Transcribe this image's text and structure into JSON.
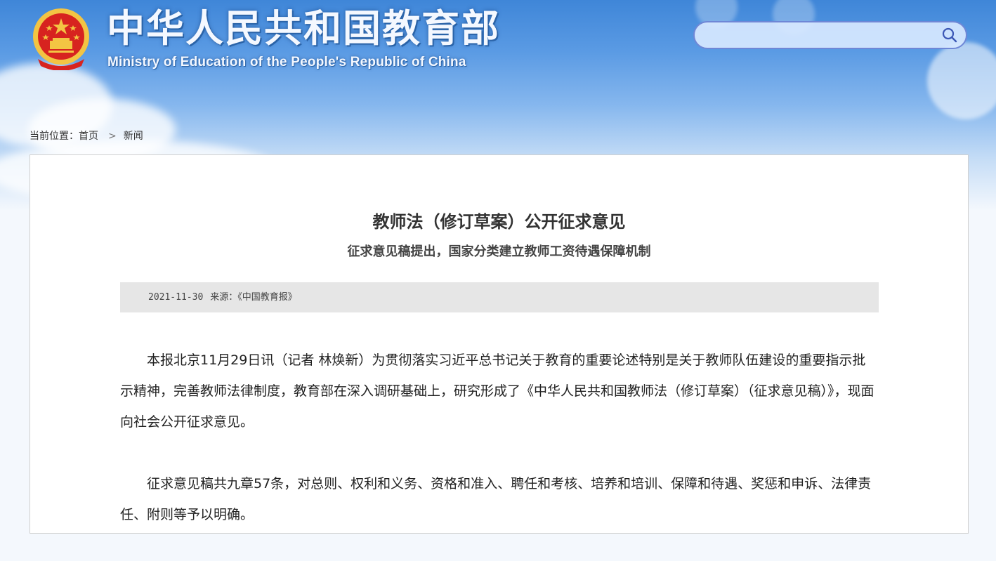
{
  "header": {
    "title_cn": "中华人民共和国教育部",
    "title_en": "Ministry of Education of the People's Republic of China"
  },
  "search": {
    "placeholder": "",
    "value": ""
  },
  "breadcrumb": {
    "label": "当前位置：",
    "home": "首页",
    "separator": ">",
    "current": "新闻"
  },
  "article": {
    "title": "教师法（修订草案）公开征求意见",
    "subtitle": "征求意见稿提出，国家分类建立教师工资待遇保障机制",
    "date": "2021-11-30",
    "source_label": "来源：",
    "source": "《中国教育报》",
    "paragraphs": [
      "本报北京11月29日讯（记者 林焕新）为贯彻落实习近平总书记关于教育的重要论述特别是关于教师队伍建设的重要指示批示精神，完善教师法律制度，教育部在深入调研基础上，研究形成了《中华人民共和国教师法（修订草案）（征求意见稿）》，现面向社会公开征求意见。",
      "征求意见稿共九章57条，对总则、权利和义务、资格和准入、聘任和考核、培养和培训、保障和待遇、奖惩和申诉、法律责任、附则等予以明确。"
    ]
  },
  "colors": {
    "banner_top": "#3f86d8",
    "banner_bottom": "#f4f8fd",
    "emblem_red": "#d7231f",
    "emblem_gold": "#f3c443",
    "search_border": "#6f87d6",
    "meta_bg": "#e6e6e6"
  }
}
